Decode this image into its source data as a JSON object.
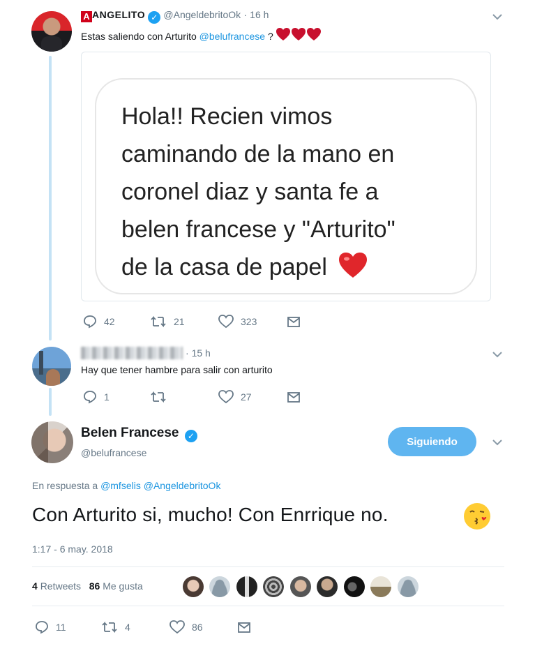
{
  "tweet1": {
    "author_name": "ANGELITO",
    "handle": "@AngeldebritoOk",
    "time": "16 h",
    "text_before": "Estas saliendo con Arturito",
    "mention": "@belufrancese",
    "text_after": "?",
    "quote_lines": [
      "Hola!! Recien vimos",
      "caminando de la mano en",
      "coronel diaz y santa fe a",
      "belen francese y \"Arturito\"",
      "de la casa de papel"
    ],
    "replies": "42",
    "retweets": "21",
    "likes": "323"
  },
  "tweet2": {
    "time": "15 h",
    "text": "Hay que tener hambre para salir con arturito",
    "replies": "1",
    "likes": "27"
  },
  "main_tweet": {
    "display_name": "Belen Francese",
    "handle": "@belufrancese",
    "follow_label": "Siguiendo",
    "reply_prefix": "En respuesta a",
    "reply_to_1": "@mfselis",
    "reply_to_2": "@AngeldebritoOk",
    "text": "Con Arturito si, mucho! Con Enrrique no.",
    "timestamp": "1:17 - 6 may. 2018",
    "retweet_count": "4",
    "retweet_label": "Retweets",
    "like_count": "86",
    "like_label": "Me gusta",
    "replies": "11",
    "retweets": "4",
    "likes": "86"
  },
  "colors": {
    "accent": "#1da1f2",
    "thread_line": "#c4e2f5",
    "muted": "#657786",
    "heart_red": "#d0021b"
  }
}
